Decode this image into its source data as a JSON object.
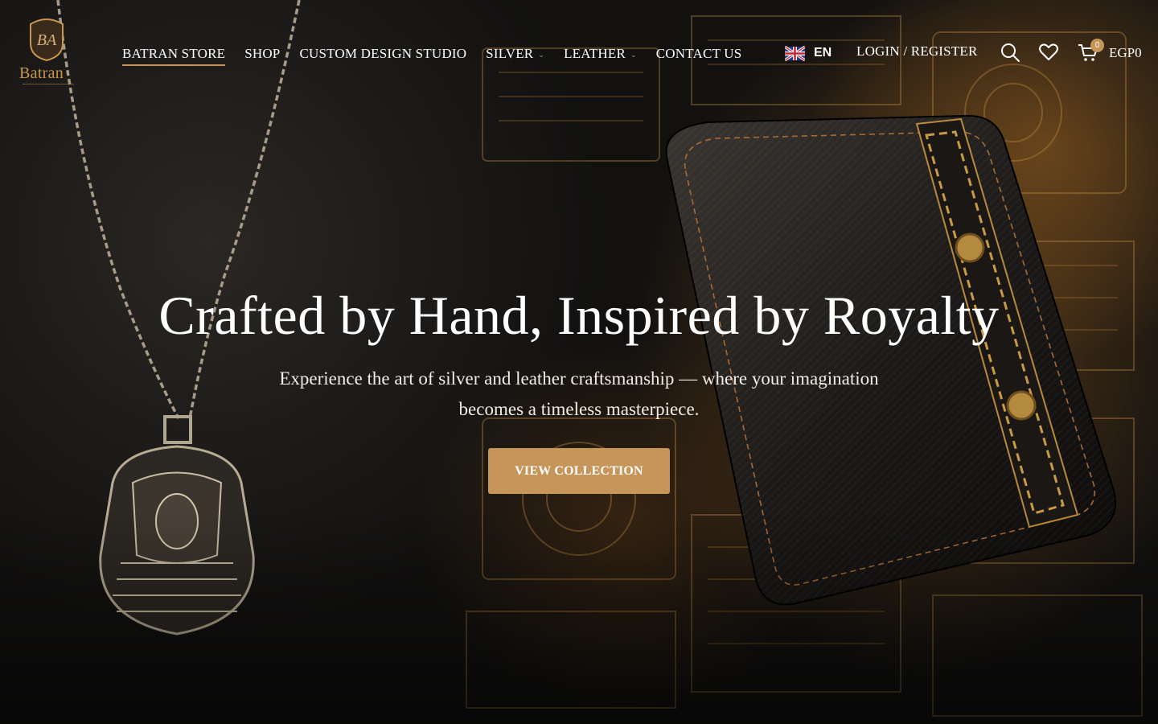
{
  "brand": {
    "name": "Batran",
    "monogram": "BA"
  },
  "nav": {
    "items": [
      {
        "label": "BATRAN STORE"
      },
      {
        "label": "SHOP"
      },
      {
        "label": "CUSTOM DESIGN STUDIO"
      },
      {
        "label": "SILVER"
      },
      {
        "label": "LEATHER"
      },
      {
        "label": "CONTACT US"
      }
    ]
  },
  "header": {
    "language_code": "EN",
    "login_label": "LOGIN / REGISTER",
    "cart_count": "0",
    "cart_total": "EGP0"
  },
  "hero": {
    "title": "Crafted by Hand, Inspired by Royalty",
    "subtitle_line1": "Experience the art of silver and leather craftsmanship — where your imagination",
    "subtitle_line2": "becomes a timeless masterpiece.",
    "cta_label": "VIEW COLLECTION"
  },
  "colors": {
    "accent": "#c6955a",
    "logo_gold": "#c8964f"
  },
  "icons": [
    "uk-flag-icon",
    "search-icon",
    "heart-icon",
    "cart-icon",
    "chevron-down-icon"
  ]
}
